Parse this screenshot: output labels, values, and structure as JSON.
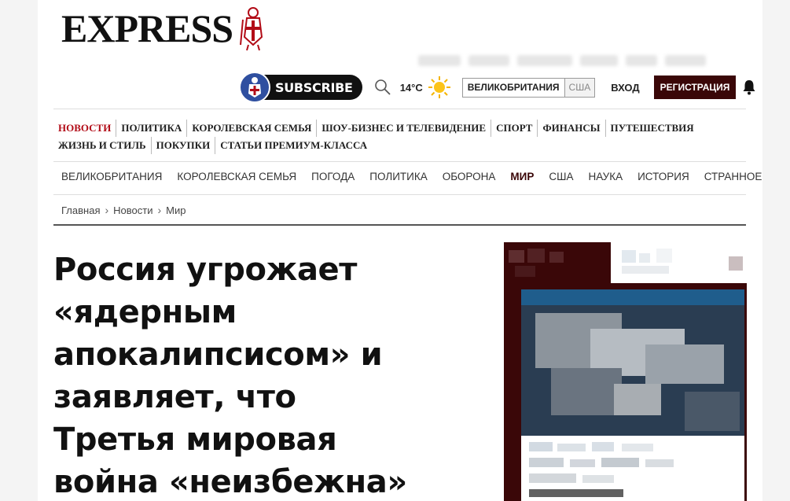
{
  "brand": {
    "logo_text": "EXPRESS"
  },
  "header": {
    "subscribe_label": "SUBSCRIBE",
    "temperature": "14°C",
    "weather_icon": "sun-icon",
    "region_active": "ВЕЛИКОБРИТАНИЯ",
    "region_other": "США",
    "login_label": "ВХОД",
    "register_label": "РЕГИСТРАЦИЯ"
  },
  "primary_nav": {
    "row1": [
      "НОВОСТИ",
      "ПОЛИТИКА",
      "КОРОЛЕВСКАЯ СЕМЬЯ",
      "ШОУ-БИЗНЕС И ТЕЛЕВИДЕНИЕ",
      "СПОРТ",
      "ФИНАНСЫ",
      "ПУТЕШЕСТВИЯ"
    ],
    "row2": [
      "ЖИЗНЬ И СТИЛЬ",
      "ПОКУПКИ",
      "СТАТЬИ ПРЕМИУМ-КЛАССА"
    ],
    "active": "НОВОСТИ"
  },
  "secondary_nav": {
    "items": [
      "ВЕЛИКОБРИТАНИЯ",
      "КОРОЛЕВСКАЯ СЕМЬЯ",
      "ПОГОДА",
      "ПОЛИТИКА",
      "ОБОРОНА",
      "МИР",
      "США",
      "НАУКА",
      "ИСТОРИЯ",
      "СТРАННОЕ"
    ],
    "active": "МИР"
  },
  "breadcrumb": [
    "Главная",
    "Новости",
    "Мир"
  ],
  "article": {
    "headline": "Россия угрожает «ядерным апокалипсисом» и заявляет, что Третья мировая война «неизбежна»"
  },
  "colors": {
    "accent_dark": "#3a0708",
    "news_red": "#b20c17",
    "subscribe_blue": "#2f4fa0"
  }
}
